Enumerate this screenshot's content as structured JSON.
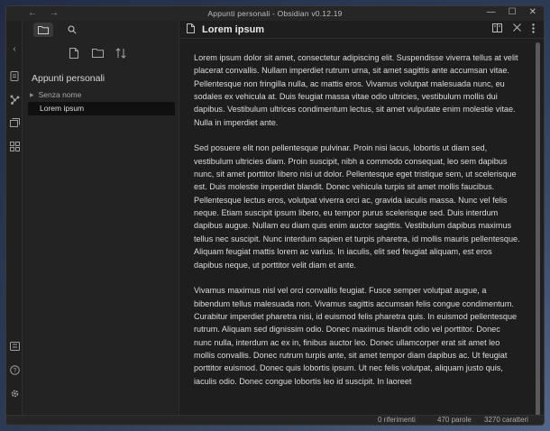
{
  "window": {
    "title": "Appunti personali - Obsidian v0.12.19",
    "nav_back": "←",
    "nav_forward": "→",
    "minimize": "—",
    "maximize": "☐",
    "close": "✕"
  },
  "sidebar": {
    "vault_name": "Appunti personali",
    "folder": "Senza nome",
    "note": "Lorem ipsum"
  },
  "editor": {
    "title": "Lorem ipsum",
    "paragraphs": [
      "Lorem ipsum dolor sit amet, consectetur adipiscing elit. Suspendisse viverra tellus at velit placerat convallis. Nullam imperdiet rutrum urna, sit amet sagittis ante accumsan vitae. Pellentesque non fringilla nulla, ac mattis eros. Vivamus volutpat malesuada nunc, eu sodales ex vehicula at. Duis feugiat massa vitae odio ultricies, vestibulum mollis dui dapibus. Vestibulum ultrices condimentum lectus, sit amet vulputate enim molestie vitae. Nulla in imperdiet ante.",
      "Sed posuere elit non pellentesque pulvinar. Proin nisi lacus, lobortis ut diam sed, vestibulum ultricies diam. Proin suscipit, nibh a commodo consequat, leo sem dapibus nunc, sit amet porttitor libero nisi ut dolor. Pellentesque eget tristique sem, ut scelerisque est. Duis molestie imperdiet blandit. Donec vehicula turpis sit amet mollis faucibus. Pellentesque lectus eros, volutpat viverra orci ac, gravida iaculis massa. Nunc vel felis neque. Etiam suscipit ipsum libero, eu tempor purus scelerisque sed. Duis interdum dapibus augue. Nullam eu diam quis enim auctor sagittis. Vestibulum dapibus maximus tellus nec suscipit. Nunc interdum sapien et turpis pharetra, id mollis mauris pellentesque. Aliquam feugiat mattis lorem ac varius. In iaculis, elit sed feugiat aliquam, est eros dapibus neque, ut porttitor velit diam et ante.",
      "Vivamus maximus nisl vel orci convallis feugiat. Fusce semper volutpat augue, a bibendum tellus malesuada non. Vivamus sagittis accumsan felis congue condimentum. Curabitur imperdiet pharetra nisi, id euismod felis pharetra quis. In euismod pellentesque rutrum. Aliquam sed dignissim odio. Donec maximus blandit odio vel porttitor. Donec nunc nulla, interdum ac ex in, finibus auctor leo. Donec ullamcorper erat sit amet leo mollis convallis. Donec rutrum turpis ante, sit amet tempor diam dapibus ac. Ut feugiat porttitor euismod. Donec quis lobortis ipsum. Ut nec felis volutpat, aliquam justo quis, iaculis odio. Donec congue lobortis leo id suscipit. In laoreet"
    ]
  },
  "status": {
    "refs": "0 riferimenti",
    "words": "470 parole",
    "chars": "3270 caratteri"
  },
  "icons": {
    "collapse_left": "‹",
    "sidebar_icons": [
      "command-palette-icon",
      "graph-icon",
      "templates-icon",
      "plugins-icon",
      "vault-icon",
      "help-icon",
      "settings-icon"
    ],
    "colors": {
      "bg": "#1e1e1e",
      "sidebar": "#232323",
      "text": "#dcdcdc"
    }
  }
}
